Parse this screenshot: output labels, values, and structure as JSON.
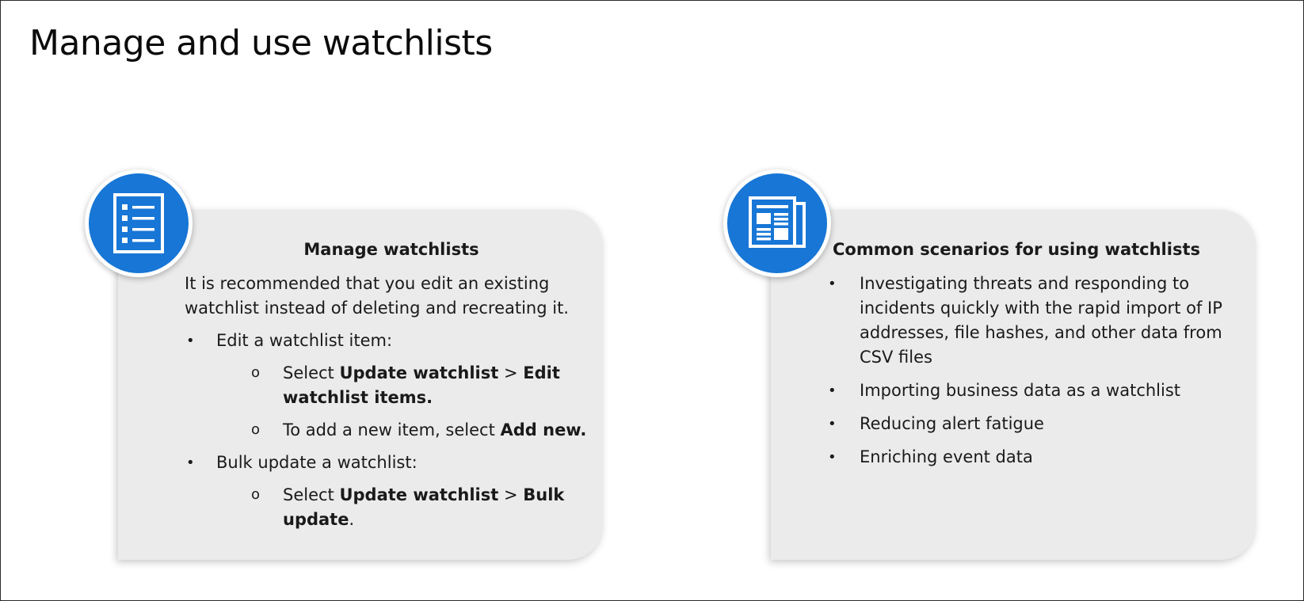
{
  "title": "Manage and use watchlists",
  "left_card": {
    "icon": "checklist-icon",
    "heading": "Manage watchlists",
    "lead": "It is recommended that you edit an existing watchlist instead of deleting and recreating it.",
    "bullets": [
      {
        "text": "Edit a watchlist item:",
        "sub": [
          {
            "pre": "Select ",
            "bold1": "Update watchlist",
            "mid": " > ",
            "bold2": "Edit watchlist items.",
            "post": ""
          },
          {
            "pre": "To add a new item, select ",
            "bold1": "Add new.",
            "mid": "",
            "bold2": "",
            "post": ""
          }
        ]
      },
      {
        "text": "Bulk update a watchlist:",
        "sub": [
          {
            "pre": "Select ",
            "bold1": "Update watchlist",
            "mid": " > ",
            "bold2": "Bulk update",
            "post": "."
          }
        ]
      }
    ]
  },
  "right_card": {
    "icon": "newspaper-icon",
    "heading": "Common scenarios for using watchlists",
    "bullets": [
      "Investigating threats and responding to incidents quickly with the rapid import of IP addresses, file hashes, and other data from CSV files",
      "Importing business data as a watchlist",
      "Reducing alert fatigue",
      "Enriching event data"
    ]
  },
  "glyphs": {
    "bullet": "•",
    "sub_bullet": "o"
  },
  "colors": {
    "accent": "#1776d6",
    "card": "#ecebec"
  }
}
